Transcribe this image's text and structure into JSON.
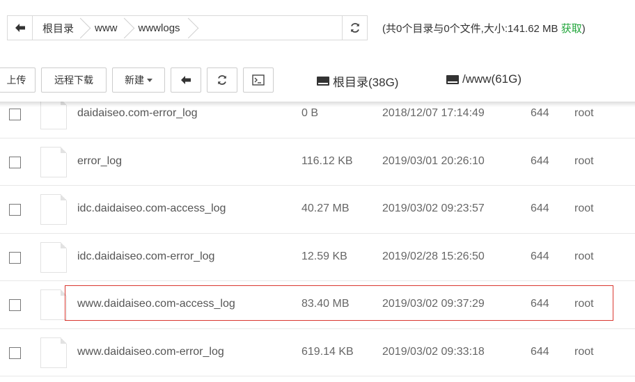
{
  "path_bar": {
    "crumbs": [
      "根目录",
      "www",
      "wwwlogs"
    ],
    "info_prefix": "(共0个目录与0个文件,大小:141.62 MB ",
    "fetch_label": "获取",
    "info_suffix": ")"
  },
  "toolbar": {
    "upload_label": "上传",
    "remote_download_label": "远程下载",
    "new_label": "新建"
  },
  "disks": [
    {
      "label": "根目录(38G)"
    },
    {
      "label": "/www(61G)"
    }
  ],
  "files": [
    {
      "name": "daidaiseo.com-error_log",
      "size": "0 B",
      "mtime": "2018/12/07 17:14:49",
      "perm": "644",
      "owner": "root"
    },
    {
      "name": "error_log",
      "size": "116.12 KB",
      "mtime": "2019/03/01 20:26:10",
      "perm": "644",
      "owner": "root"
    },
    {
      "name": "idc.daidaiseo.com-access_log",
      "size": "40.27 MB",
      "mtime": "2019/03/02 09:23:57",
      "perm": "644",
      "owner": "root"
    },
    {
      "name": "idc.daidaiseo.com-error_log",
      "size": "12.59 KB",
      "mtime": "2019/02/28 15:26:50",
      "perm": "644",
      "owner": "root"
    },
    {
      "name": "www.daidaiseo.com-access_log",
      "size": "83.40 MB",
      "mtime": "2019/03/02 09:37:29",
      "perm": "644",
      "owner": "root"
    },
    {
      "name": "www.daidaiseo.com-error_log",
      "size": "619.14 KB",
      "mtime": "2019/03/02 09:33:18",
      "perm": "644",
      "owner": "root"
    }
  ],
  "colors": {
    "highlight": "#d9362f",
    "fetch_link": "#20a53a"
  },
  "icons": [
    "back-arrow-icon",
    "refresh-icon",
    "terminal-icon",
    "hard-drive-icon",
    "file-icon",
    "checkbox-icon"
  ]
}
